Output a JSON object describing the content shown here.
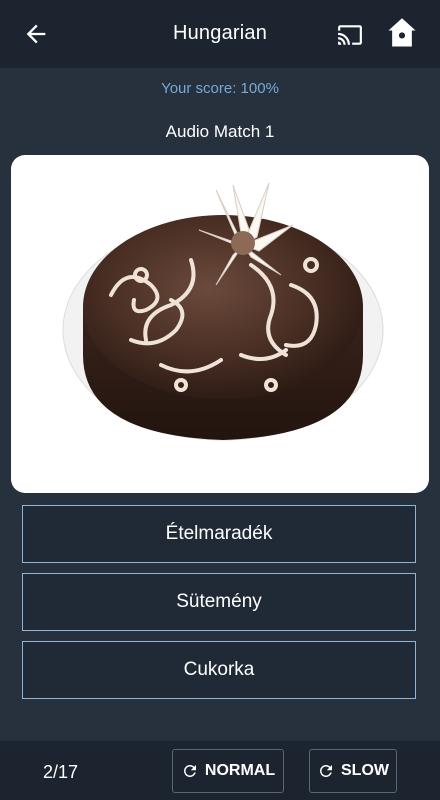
{
  "header": {
    "title": "Hungarian",
    "back_icon": "arrow-left-icon",
    "cast_icon": "cast-icon",
    "home_icon": "home-icon"
  },
  "score": {
    "text": "Your score: 100%"
  },
  "exercise": {
    "title": "Audio Match 1",
    "image_subject": "chocolate-cake"
  },
  "answers": [
    {
      "label": "Ételmaradék"
    },
    {
      "label": "Sütemény"
    },
    {
      "label": "Cukorka"
    }
  ],
  "footer": {
    "progress": "2/17",
    "normal_label": "NORMAL",
    "slow_label": "SLOW",
    "replay_icon": "replay-icon"
  },
  "colors": {
    "background": "#26313d",
    "bar": "#1c2430",
    "score": "#76a9d8",
    "answer_border": "#8fb6d6"
  }
}
